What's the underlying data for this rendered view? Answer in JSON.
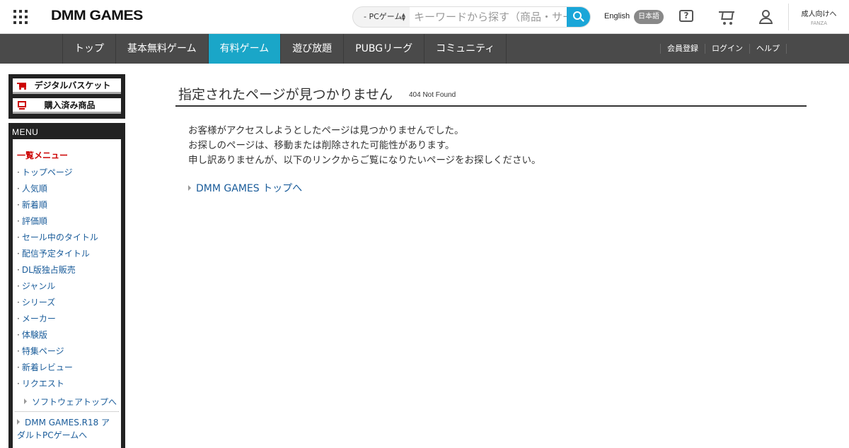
{
  "header": {
    "logo": "DMM GAMES",
    "search": {
      "category": "- PCゲーム",
      "placeholder": "キーワードから探す（商品・サークル・作家名）"
    },
    "lang_en": "English",
    "lang_ja": "日本語",
    "adult_label": "成人向けへ",
    "adult_sub": "FANZA"
  },
  "nav": {
    "tabs": [
      {
        "label": "トップ"
      },
      {
        "label": "基本無料ゲーム"
      },
      {
        "label": "有料ゲーム",
        "active": true
      },
      {
        "label": "遊び放題"
      },
      {
        "label": "PUBGリーグ"
      },
      {
        "label": "コミュニティ"
      }
    ],
    "links": [
      "会員登録",
      "ログイン",
      "ヘルプ"
    ]
  },
  "sidebar": {
    "basket_label": "デジタルバスケット",
    "purchased_label": "購入済み商品",
    "menu_title": "MENU",
    "menu_heading": "一覧メニュー",
    "items": [
      "トップページ",
      "人気順",
      "新着順",
      "評価順",
      "セール中のタイトル",
      "配信予定タイトル",
      "DL版独占販売",
      "ジャンル",
      "シリーズ",
      "メーカー",
      "体験版",
      "特集ページ",
      "新着レビュー",
      "リクエスト"
    ],
    "software_top": "ソフトウェアトップへ",
    "r18_link": "DMM GAMES.R18 アダルトPCゲームへ"
  },
  "main": {
    "title": "指定されたページが見つかりません",
    "subtitle": "404 Not Found",
    "messages": [
      "お客様がアクセスしようとしたページは見つかりませんでした。",
      "お探しのページは、移動または削除された可能性があります。",
      "申し訳ありませんが、以下のリンクからご覧になりたいページをお探しください。"
    ],
    "back_link": "DMM GAMES トップへ"
  },
  "colors": {
    "accent": "#1aa6c8",
    "nav_bg": "#4a4a4a",
    "link": "#1a5c9a",
    "menu_heading": "#cc0000"
  }
}
